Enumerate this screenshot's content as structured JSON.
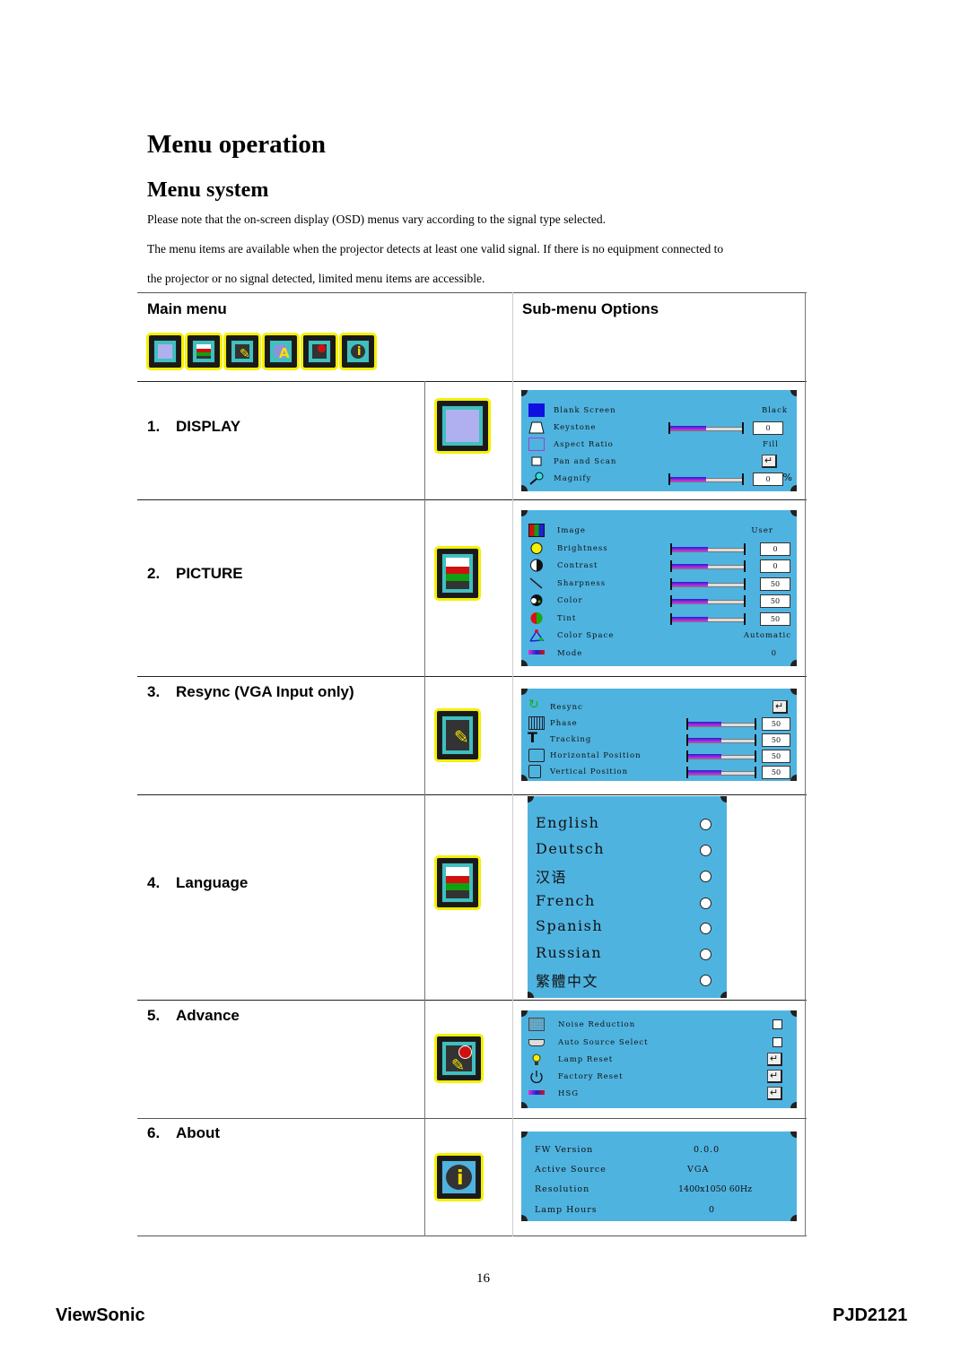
{
  "page": {
    "title": "Menu operation",
    "section_title": "Menu system",
    "paragraphs": [
      "Please note that the on-screen display (OSD) menus vary according to the signal type selected.",
      "The menu items are available when the projector detects at least one valid signal. If there is no equipment connected to",
      "the projector or no signal detected, limited menu items are accessible."
    ]
  },
  "table": {
    "col_main": "Main menu",
    "col_sub": "Sub-menu Options",
    "main_icons": [
      "display-icon",
      "picture-icon",
      "resync-icon",
      "language-icon",
      "advance-icon",
      "about-icon"
    ],
    "rows": [
      {
        "num": "1.",
        "label": "DISPLAY",
        "icon": "display-icon"
      },
      {
        "num": "2.",
        "label": "PICTURE",
        "icon": "picture-icon"
      },
      {
        "num": "3.",
        "label": "Resync (VGA Input only)",
        "icon": "resync-icon"
      },
      {
        "num": "4.",
        "label": "Language",
        "icon": "language-icon"
      },
      {
        "num": "5.",
        "label": "Advance",
        "icon": "advance-icon"
      },
      {
        "num": "6.",
        "label": "About",
        "icon": "about-icon"
      }
    ]
  },
  "osd": {
    "display": [
      {
        "icon": "blank-screen-icon",
        "label": "Blank Screen",
        "value": "Black"
      },
      {
        "icon": "keystone-icon",
        "label": "Keystone",
        "slider": 0.5,
        "value": "0"
      },
      {
        "icon": "aspect-ratio-icon",
        "label": "Aspect Ratio",
        "value": "Fill"
      },
      {
        "icon": "pan-scan-icon",
        "label": "Pan and Scan",
        "enter": "↵"
      },
      {
        "icon": "magnify-icon",
        "label": "Magnify",
        "slider": 0.5,
        "value": "0",
        "unit": "%"
      }
    ],
    "picture": [
      {
        "icon": "image-icon",
        "label": "Image",
        "value": "User"
      },
      {
        "icon": "brightness-icon",
        "label": "Brightness",
        "slider": 0.5,
        "value": "0"
      },
      {
        "icon": "contrast-icon",
        "label": "Contrast",
        "slider": 0.5,
        "value": "0"
      },
      {
        "icon": "sharpness-icon",
        "label": "Sharpness",
        "slider": 0.5,
        "value": "50"
      },
      {
        "icon": "color-icon",
        "label": "Color",
        "slider": 0.5,
        "value": "50"
      },
      {
        "icon": "tint-icon",
        "label": "Tint",
        "slider": 0.5,
        "value": "50"
      },
      {
        "icon": "color-space-icon",
        "label": "Color Space",
        "value": "Automatic"
      },
      {
        "icon": "mode-icon",
        "label": "Mode",
        "value": "0"
      }
    ],
    "resync": [
      {
        "icon": "resync-arrow-icon",
        "label": "Resync",
        "enter": "↵"
      },
      {
        "icon": "phase-icon",
        "label": "Phase",
        "slider": 0.5,
        "value": "50"
      },
      {
        "icon": "tracking-icon",
        "label": "Tracking",
        "slider": 0.5,
        "value": "50"
      },
      {
        "icon": "horizontal-position-icon",
        "label": "Horizontal Position",
        "slider": 0.5,
        "value": "50"
      },
      {
        "icon": "vertical-position-icon",
        "label": "Vertical Position",
        "slider": 0.5,
        "value": "50"
      }
    ],
    "language": [
      "English",
      "Deutsch",
      "汉语",
      "French",
      "Spanish",
      "Russian",
      "繁體中文"
    ],
    "advance": [
      {
        "icon": "noise-reduction-icon",
        "label": "Noise Reduction",
        "control": "checkbox"
      },
      {
        "icon": "auto-source-icon",
        "label": "Auto Source Select",
        "control": "checkbox"
      },
      {
        "icon": "lamp-icon",
        "label": "Lamp Reset",
        "enter": "↵"
      },
      {
        "icon": "power-icon",
        "label": "Factory Reset",
        "enter": "↵"
      },
      {
        "icon": "hsg-icon",
        "label": "HSG",
        "enter": "↵"
      }
    ],
    "about": [
      {
        "label": "FW Version",
        "value": "0.0.0"
      },
      {
        "label": "Active Source",
        "value": "VGA"
      },
      {
        "label": "Resolution",
        "value": "1400x1050 60Hz"
      },
      {
        "label": "Lamp Hours",
        "value": "0"
      }
    ]
  },
  "footer": {
    "page_number": "16",
    "brand": "ViewSonic",
    "model": "PJD2121"
  },
  "colors": {
    "osd_bg": "#4fb3e0",
    "icon_border": "#f5f000",
    "icon_inner": "#40bfbf"
  }
}
